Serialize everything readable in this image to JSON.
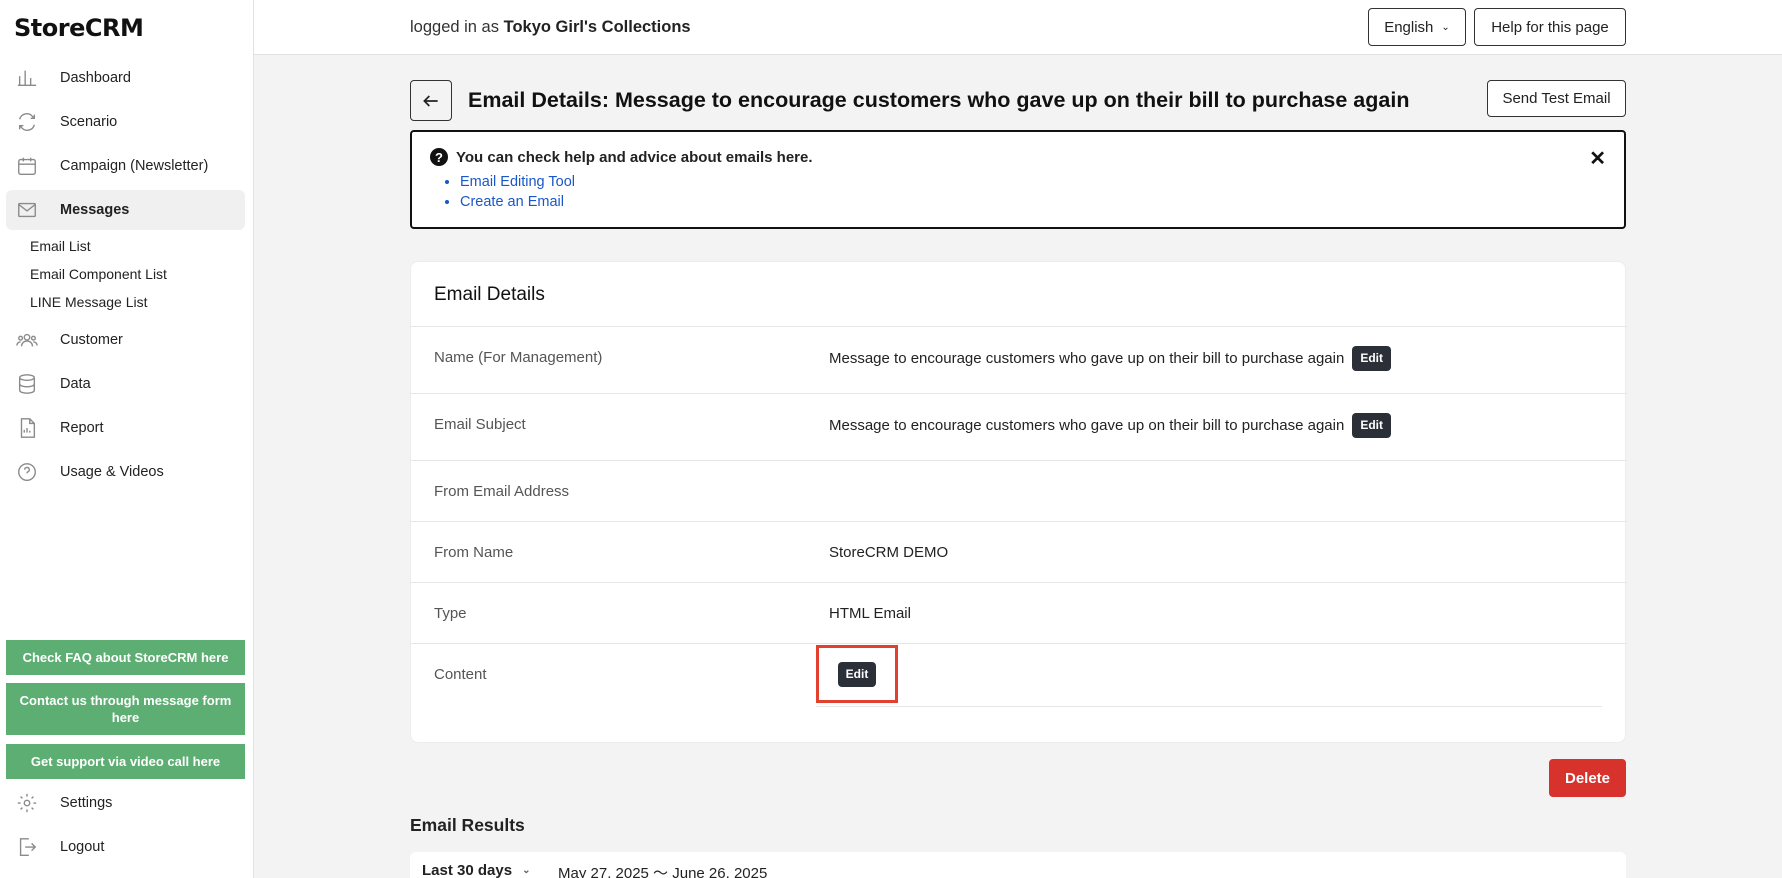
{
  "app": {
    "name": "StoreCRM"
  },
  "sidebar": {
    "items": [
      {
        "label": "Dashboard",
        "icon": "bar-chart-icon"
      },
      {
        "label": "Scenario",
        "icon": "refresh-icon"
      },
      {
        "label": "Campaign (Newsletter)",
        "icon": "calendar-icon"
      },
      {
        "label": "Messages",
        "icon": "mail-icon"
      }
    ],
    "messages_sub": [
      "Email List",
      "Email Component List",
      "LINE Message List"
    ],
    "items2": [
      {
        "label": "Customer",
        "icon": "users-icon"
      },
      {
        "label": "Data",
        "icon": "database-icon"
      },
      {
        "label": "Report",
        "icon": "report-icon"
      },
      {
        "label": "Usage & Videos",
        "icon": "help-circle-icon"
      }
    ],
    "support": {
      "faq": "Check FAQ about StoreCRM here",
      "contact": "Contact us through message form here",
      "video": "Get support via video call here"
    },
    "settings": "Settings",
    "logout": "Logout"
  },
  "header": {
    "logged_prefix": "logged in as",
    "store": "Tokyo Girl's Collections",
    "language": "English",
    "help": "Help for this page"
  },
  "page": {
    "title": "Email Details: Message to encourage customers who gave up on their bill to purchase again",
    "send_test": "Send Test Email"
  },
  "help_box": {
    "heading": "You can check help and advice about emails here.",
    "links": [
      "Email Editing Tool",
      "Create an Email"
    ]
  },
  "details": {
    "title": "Email Details",
    "rows": [
      {
        "label": "Name (For Management)",
        "value": "Message to encourage customers who gave up on their bill to purchase again"
      },
      {
        "label": "Email Subject",
        "value": "Message to encourage customers who gave up on their bill to purchase again"
      },
      {
        "label": "From Email Address",
        "value": ""
      },
      {
        "label": "From Name",
        "value": "StoreCRM DEMO"
      },
      {
        "label": "Type",
        "value": "HTML Email"
      },
      {
        "label": "Content",
        "value": ""
      }
    ],
    "edit_label": "Edit",
    "delete_label": "Delete"
  },
  "results": {
    "title": "Email Results",
    "period": "Last 30 days",
    "range": "May 27, 2025 〜 June 26, 2025"
  },
  "colors": {
    "accent_green": "#5cae72",
    "danger": "#d8322c",
    "highlight": "#e2412f",
    "link": "#1a57c8"
  }
}
